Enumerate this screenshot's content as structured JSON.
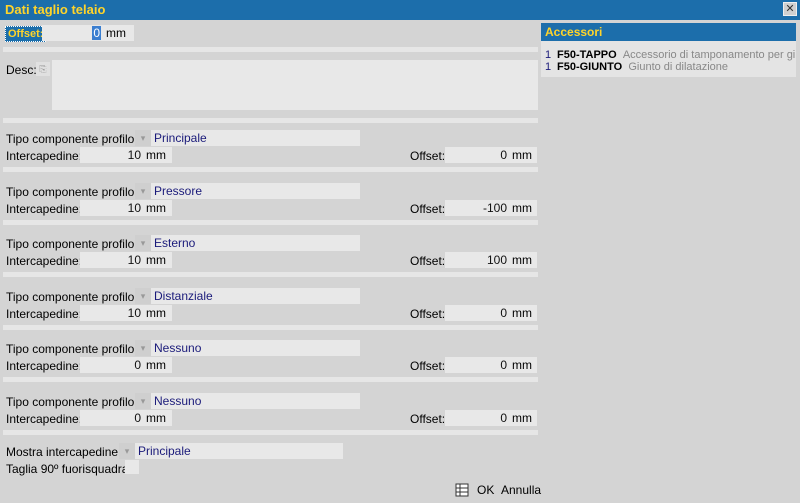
{
  "window": {
    "title": "Dati taglio telaio",
    "close": "✕"
  },
  "offset_top": {
    "label": "Offset:",
    "value": "0",
    "unit": "mm"
  },
  "desc": {
    "label": "Desc:",
    "value": ""
  },
  "components": [
    {
      "tipo_label": "Tipo componente profilo:",
      "tipo": "Principale",
      "inter_label": "Intercapedine:",
      "inter": "10",
      "inter_unit": "mm",
      "off_label": "Offset:",
      "off": "0",
      "off_unit": "mm"
    },
    {
      "tipo_label": "Tipo componente profilo:",
      "tipo": "Pressore",
      "inter_label": "Intercapedine:",
      "inter": "10",
      "inter_unit": "mm",
      "off_label": "Offset:",
      "off": "-100",
      "off_unit": "mm"
    },
    {
      "tipo_label": "Tipo componente profilo:",
      "tipo": "Esterno",
      "inter_label": "Intercapedine:",
      "inter": "10",
      "inter_unit": "mm",
      "off_label": "Offset:",
      "off": "100",
      "off_unit": "mm"
    },
    {
      "tipo_label": "Tipo componente profilo:",
      "tipo": "Distanziale",
      "inter_label": "Intercapedine:",
      "inter": "10",
      "inter_unit": "mm",
      "off_label": "Offset:",
      "off": "0",
      "off_unit": "mm"
    },
    {
      "tipo_label": "Tipo componente profilo:",
      "tipo": "Nessuno",
      "inter_label": "Intercapedine:",
      "inter": "0",
      "inter_unit": "mm",
      "off_label": "Offset:",
      "off": "0",
      "off_unit": "mm"
    },
    {
      "tipo_label": "Tipo componente profilo:",
      "tipo": "Nessuno",
      "inter_label": "Intercapedine:",
      "inter": "0",
      "inter_unit": "mm",
      "off_label": "Offset:",
      "off": "0",
      "off_unit": "mm"
    }
  ],
  "mostra": {
    "label": "Mostra intercapedine:",
    "value": "Principale"
  },
  "taglia": {
    "label": "Taglia 90º fuorisquadra:"
  },
  "accessori": {
    "title": "Accessori",
    "items": [
      {
        "qty": "1",
        "code": "F50-TAPPO",
        "desc": "Accessorio di tamponamento per gi"
      },
      {
        "qty": "1",
        "code": "F50-GIUNTO",
        "desc": "Giunto di dilatazione"
      }
    ]
  },
  "buttons": {
    "ok": "OK",
    "cancel": "Annulla"
  },
  "icons": {
    "dropdown": "dropdown-arrow-icon",
    "table": "table-icon"
  }
}
